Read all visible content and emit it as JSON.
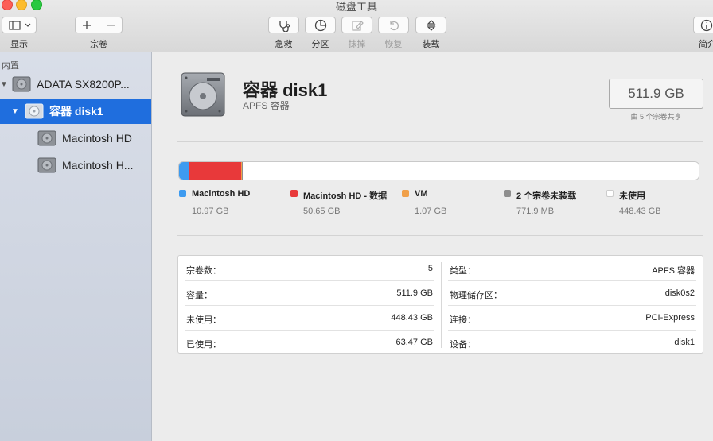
{
  "window": {
    "title": "磁盘工具"
  },
  "toolbar": {
    "view_label": "显示",
    "volume_label": "宗卷",
    "firstaid_label": "急救",
    "partition_label": "分区",
    "erase_label": "抹掉",
    "restore_label": "恢复",
    "mount_label": "装载",
    "info_label": "简介"
  },
  "sidebar": {
    "section": "内置",
    "items": [
      {
        "label": "ADATA SX8200P..."
      },
      {
        "label": "容器 disk1"
      },
      {
        "label": "Macintosh HD"
      },
      {
        "label": "Macintosh H..."
      }
    ]
  },
  "volume": {
    "name": "容器 disk1",
    "subtitle": "APFS 容器",
    "capacity": "511.9 GB",
    "shared_note": "由 5 个宗卷共享"
  },
  "usage": {
    "segments": [
      {
        "name": "Macintosh HD",
        "size": "10.97 GB",
        "color": "#3d9bf0",
        "fraction": 0.02
      },
      {
        "name": "Macintosh HD - 数据",
        "size": "50.65 GB",
        "color": "#e8393a",
        "fraction": 0.099
      },
      {
        "name": "VM",
        "size": "1.07 GB",
        "color": "#f0a04a",
        "fraction": 0.002
      },
      {
        "name": "2 个宗卷未装载",
        "size": "771.9 MB",
        "color": "#8e8e8e",
        "fraction": 0.0015
      },
      {
        "name": "未使用",
        "size": "448.43 GB",
        "color": "#ffffff",
        "fraction": 0.876
      }
    ]
  },
  "info": {
    "left": [
      {
        "key": "宗卷数：",
        "value": "5"
      },
      {
        "key": "容量：",
        "value": "511.9 GB"
      },
      {
        "key": "未使用：",
        "value": "448.43 GB"
      },
      {
        "key": "已使用：",
        "value": "63.47 GB"
      }
    ],
    "right": [
      {
        "key": "类型：",
        "value": "APFS 容器"
      },
      {
        "key": "物理储存区：",
        "value": "disk0s2"
      },
      {
        "key": "连接：",
        "value": "PCI-Express"
      },
      {
        "key": "设备：",
        "value": "disk1"
      }
    ]
  }
}
